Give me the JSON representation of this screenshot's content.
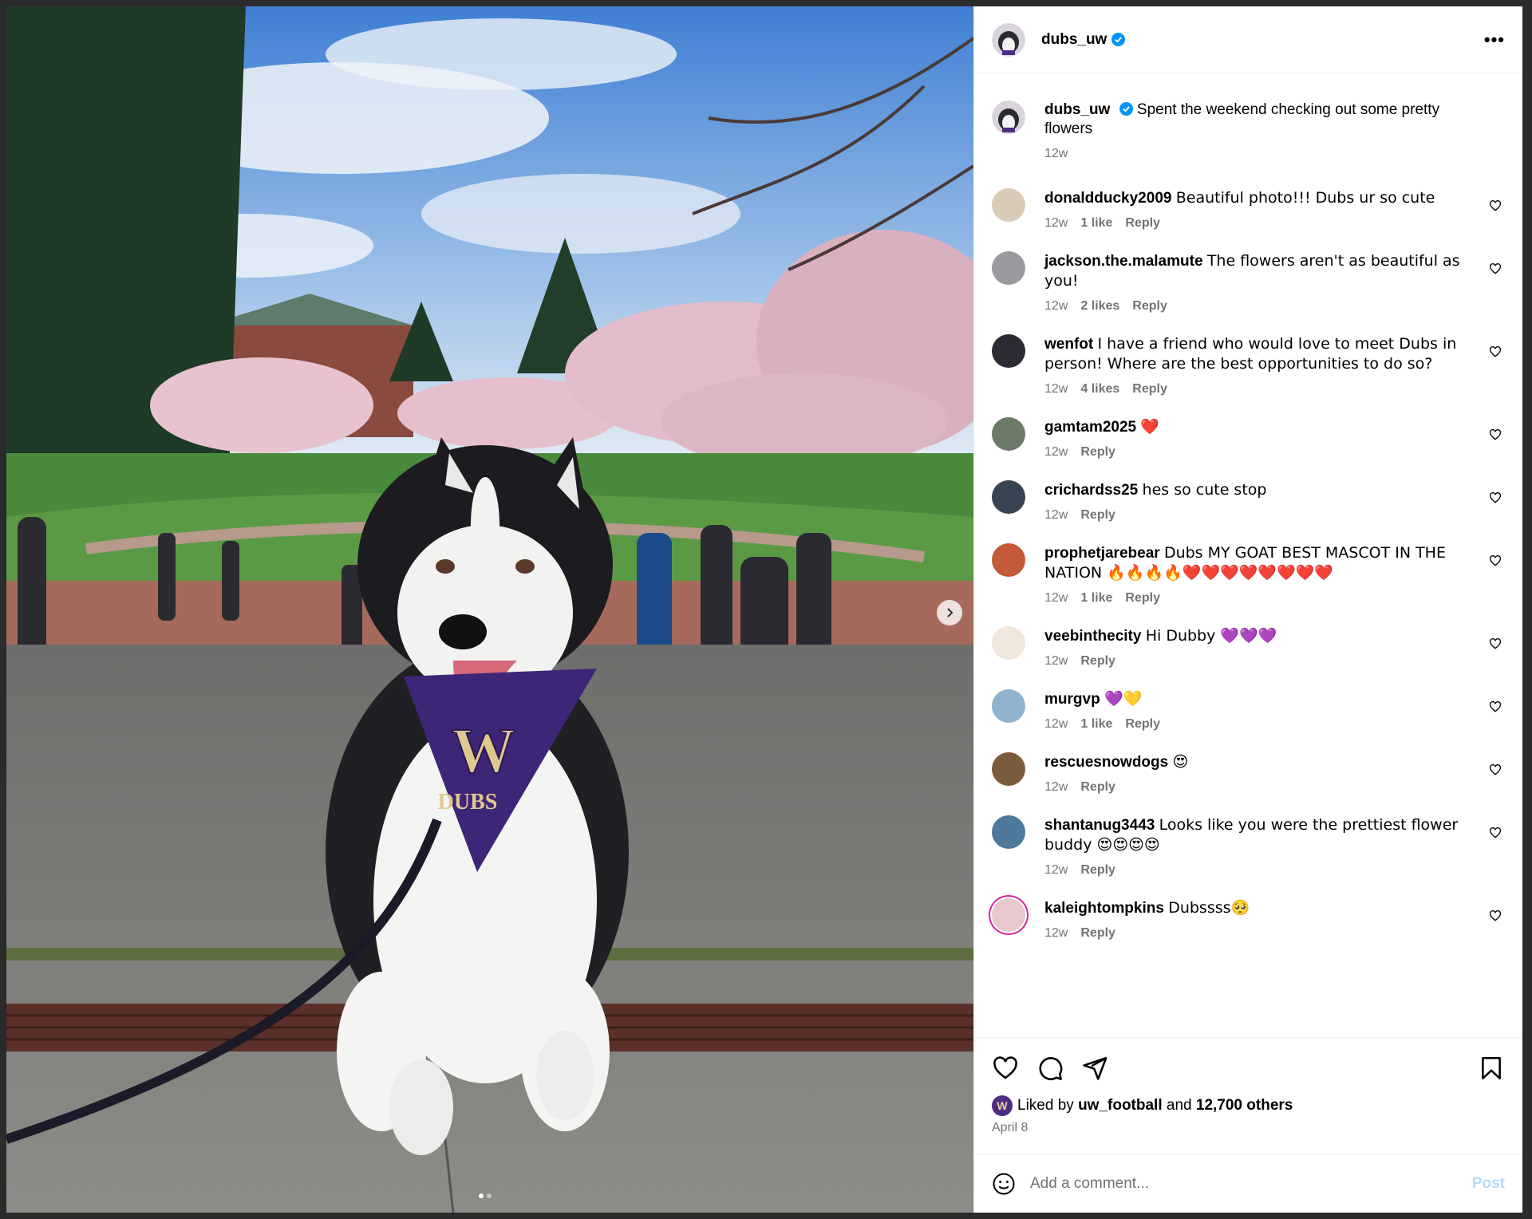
{
  "post": {
    "username": "dubs_uw",
    "caption": "Spent the weekend checking out some pretty flowers",
    "caption_time": "12w",
    "liked_by_prefix": "Liked by",
    "liked_by_user": "uw_football",
    "liked_by_and": "and",
    "liked_by_others": "12,700 others",
    "liked_by_avatar_letter": "W",
    "date": "April 8"
  },
  "photo": {
    "bandana_letter": "W",
    "bandana_text": "DUBS"
  },
  "comments": [
    {
      "user": "donaldducky2009",
      "text": "Beautiful photo!!! Dubs ur so cute",
      "time": "12w",
      "likes": "1 like",
      "reply": "Reply"
    },
    {
      "user": "jackson.the.malamute",
      "text": "The flowers aren't as beautiful as you!",
      "time": "12w",
      "likes": "2 likes",
      "reply": "Reply"
    },
    {
      "user": "wenfot",
      "text": "I have a friend who would love to meet Dubs in person! Where are the best opportunities to do so?",
      "time": "12w",
      "likes": "4 likes",
      "reply": "Reply"
    },
    {
      "user": "gamtam2025",
      "text": "❤️",
      "time": "12w",
      "likes": "",
      "reply": "Reply"
    },
    {
      "user": "crichardss25",
      "text": "hes so cute stop",
      "time": "12w",
      "likes": "",
      "reply": "Reply"
    },
    {
      "user": "prophetjarebear",
      "text": "Dubs MY GOAT BEST MASCOT IN THE NATION 🔥🔥🔥🔥❤️❤️❤️❤️❤️❤️❤️❤️",
      "time": "12w",
      "likes": "1 like",
      "reply": "Reply"
    },
    {
      "user": "veebinthecity",
      "text": "Hi Dubby 💜💜💜",
      "time": "12w",
      "likes": "",
      "reply": "Reply"
    },
    {
      "user": "murgvp",
      "text": "💜💛",
      "time": "12w",
      "likes": "1 like",
      "reply": "Reply"
    },
    {
      "user": "rescuesnowdogs",
      "text": "😍",
      "time": "12w",
      "likes": "",
      "reply": "Reply"
    },
    {
      "user": "shantanug3443",
      "text": "Looks like you were the prettiest flower buddy 😍😍😍😍",
      "time": "12w",
      "likes": "",
      "reply": "Reply"
    },
    {
      "user": "kaleightompkins",
      "text": "Dubssss🥺",
      "time": "12w",
      "likes": "",
      "reply": "Reply"
    }
  ],
  "add_comment": {
    "placeholder": "Add a comment...",
    "post_label": "Post"
  },
  "icons": {
    "more": "more-options-icon",
    "heart": "heart-icon",
    "comment": "comment-icon",
    "share": "share-icon",
    "bookmark": "bookmark-icon",
    "emoji": "emoji-icon",
    "next": "chevron-right-icon"
  },
  "colors": {
    "verified": "#0095f6",
    "muted": "#737373",
    "post_disabled": "#b3dbff",
    "uw_purple": "#4b2e83"
  }
}
